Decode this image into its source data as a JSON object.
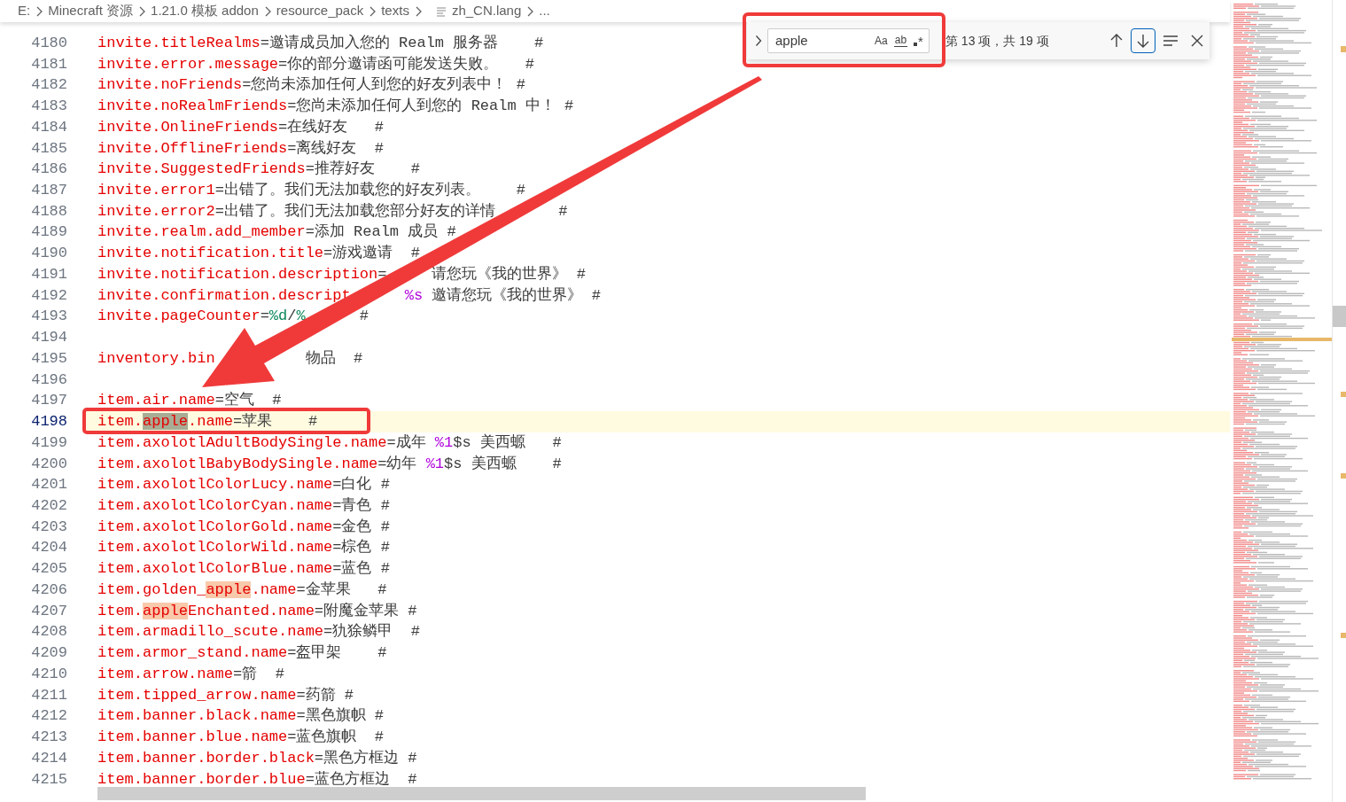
{
  "breadcrumb": [
    {
      "kind": "folder",
      "text": "E:"
    },
    {
      "kind": "folder",
      "text": "Minecraft 资源"
    },
    {
      "kind": "folder",
      "text": "1.21.0 模板 addon"
    },
    {
      "kind": "folder",
      "text": "resource_pack"
    },
    {
      "kind": "folder",
      "text": "texts"
    },
    {
      "kind": "file",
      "text": "zh_CN.lang"
    },
    {
      "kind": "more",
      "text": "..."
    }
  ],
  "find_widget": {
    "query": "apple",
    "toggles": [
      {
        "kind": "match_case",
        "label": "Aa",
        "on": false
      },
      {
        "kind": "whole_word",
        "label": "ab",
        "on": false
      },
      {
        "kind": "regex",
        "label": "*",
        "on": false
      }
    ],
    "result": "第 13 项，共 19 项"
  },
  "editor": {
    "lines": [
      {
        "number": "4180",
        "current": false,
        "tokens": [
          {
            "kind": "key",
            "text": "invite.titleRealms"
          },
          {
            "kind": "value",
            "text": "=邀请成员加入您的 Realm 服务器    #"
          }
        ]
      },
      {
        "number": "4181",
        "current": false,
        "tokens": [
          {
            "kind": "key",
            "text": "invite.error.message"
          },
          {
            "kind": "value",
            "text": "=你的部分邀请函可能发送失败。   #"
          }
        ]
      },
      {
        "number": "4182",
        "current": false,
        "tokens": [
          {
            "kind": "key",
            "text": "invite.noFriends"
          },
          {
            "kind": "value",
            "text": "=您尚未添加任何人到您的好友列表中！ #"
          }
        ]
      },
      {
        "number": "4183",
        "current": false,
        "tokens": [
          {
            "kind": "key",
            "text": "invite.noRealmFriends"
          },
          {
            "kind": "value",
            "text": "=您尚未添加任何人到您的 Realm 中！ #"
          }
        ]
      },
      {
        "number": "4184",
        "current": false,
        "tokens": [
          {
            "kind": "key",
            "text": "invite.OnlineFriends"
          },
          {
            "kind": "value",
            "text": "=在线好友   #"
          }
        ]
      },
      {
        "number": "4185",
        "current": false,
        "tokens": [
          {
            "kind": "key",
            "text": "invite.OfflineFriends"
          },
          {
            "kind": "value",
            "text": "=离线好友  #"
          }
        ]
      },
      {
        "number": "4186",
        "current": false,
        "tokens": [
          {
            "kind": "key",
            "text": "invite.SuggestedFriends"
          },
          {
            "kind": "value",
            "text": "=推荐好友    #"
          }
        ]
      },
      {
        "number": "4187",
        "current": false,
        "tokens": [
          {
            "kind": "key",
            "text": "invite.error1"
          },
          {
            "kind": "value",
            "text": "=出错了。我们无法加载您的好友列表。    #"
          }
        ]
      },
      {
        "number": "4188",
        "current": false,
        "tokens": [
          {
            "kind": "key",
            "text": "invite.error2"
          },
          {
            "kind": "value",
            "text": "=出错了。我们无法加载您部分好友的详情       #"
          }
        ]
      },
      {
        "number": "4189",
        "current": false,
        "tokens": [
          {
            "kind": "key",
            "text": "invite.realm.add_member"
          },
          {
            "kind": "value",
            "text": "=添加 Realm 成员 #"
          }
        ]
      },
      {
        "number": "4190",
        "current": false,
        "tokens": [
          {
            "kind": "key",
            "text": "invite.notification.title"
          },
          {
            "kind": "value",
            "text": "=游戏邀请  #"
          }
        ]
      },
      {
        "number": "4191",
        "current": false,
        "tokens": [
          {
            "kind": "key",
            "text": "invite.notification.description"
          },
          {
            "kind": "value",
            "text": "=     请您玩《我的世界》 #"
          }
        ]
      },
      {
        "number": "4192",
        "current": false,
        "tokens": [
          {
            "kind": "key",
            "text": "invite.confirmation.descript      "
          },
          {
            "kind": "format",
            "text": "%s"
          },
          {
            "kind": "value",
            "text": " 邀请您玩《我的世界》 #"
          }
        ]
      },
      {
        "number": "4193",
        "current": false,
        "tokens": [
          {
            "kind": "key",
            "text": "invite.pageCounter"
          },
          {
            "kind": "value",
            "text": "="
          },
          {
            "kind": "counter",
            "text": "%d"
          },
          {
            "kind": "value",
            "text": "/"
          },
          {
            "kind": "counter",
            "text": "%"
          },
          {
            "kind": "value",
            "text": "      #"
          }
        ]
      },
      {
        "number": "4194",
        "current": false
      },
      {
        "number": "4195",
        "current": false,
        "tokens": [
          {
            "kind": "key",
            "text": "inventory.bin"
          },
          {
            "kind": "value",
            "text": "          物品  #"
          }
        ]
      },
      {
        "number": "4196",
        "current": false
      },
      {
        "number": "4197",
        "current": false,
        "tokens": [
          {
            "kind": "key",
            "text": "item.air.name"
          },
          {
            "kind": "value",
            "text": "=空气  #"
          }
        ]
      },
      {
        "number": "4198",
        "current": true,
        "tokens": [
          {
            "kind": "key",
            "text": "item."
          },
          {
            "kind": "key",
            "text": "apple",
            "match": true,
            "current_match": true
          },
          {
            "kind": "key",
            "text": ".name"
          },
          {
            "kind": "value",
            "text": "=苹果    #"
          }
        ]
      },
      {
        "number": "4199",
        "current": false,
        "tokens": [
          {
            "kind": "key",
            "text": "item.axolotlAdultBodySingle.name"
          },
          {
            "kind": "value",
            "text": "=成年 "
          },
          {
            "kind": "format",
            "text": "%1"
          },
          {
            "kind": "value",
            "text": "$s 美西螈   #"
          }
        ]
      },
      {
        "number": "4200",
        "current": false,
        "tokens": [
          {
            "kind": "key",
            "text": "item.axolotlBabyBodySingle.name"
          },
          {
            "kind": "value",
            "text": "=幼年 "
          },
          {
            "kind": "format",
            "text": "%1"
          },
          {
            "kind": "value",
            "text": "$s 美西螈    #"
          }
        ]
      },
      {
        "number": "4201",
        "current": false,
        "tokens": [
          {
            "kind": "key",
            "text": "item.axolotlColorLucy.name"
          },
          {
            "kind": "value",
            "text": "=白化 #"
          }
        ]
      },
      {
        "number": "4202",
        "current": false,
        "tokens": [
          {
            "kind": "key",
            "text": "item.axolotlColorCyan.name"
          },
          {
            "kind": "value",
            "text": "=青色 #"
          }
        ]
      },
      {
        "number": "4203",
        "current": false,
        "tokens": [
          {
            "kind": "key",
            "text": "item.axolotlColorGold.name"
          },
          {
            "kind": "value",
            "text": "=金色 #"
          }
        ]
      },
      {
        "number": "4204",
        "current": false,
        "tokens": [
          {
            "kind": "key",
            "text": "item.axolotlColorWild.name"
          },
          {
            "kind": "value",
            "text": "=棕色 #"
          }
        ]
      },
      {
        "number": "4205",
        "current": false,
        "tokens": [
          {
            "kind": "key",
            "text": "item.axolotlColorBlue.name"
          },
          {
            "kind": "value",
            "text": "=蓝色 #"
          }
        ]
      },
      {
        "number": "4206",
        "current": false,
        "tokens": [
          {
            "kind": "key",
            "text": "item.golden_"
          },
          {
            "kind": "key",
            "text": "apple",
            "match": true,
            "current_match": false
          },
          {
            "kind": "key",
            "text": ".name"
          },
          {
            "kind": "value",
            "text": "=金苹果   #"
          }
        ]
      },
      {
        "number": "4207",
        "current": false,
        "tokens": [
          {
            "kind": "key",
            "text": "item."
          },
          {
            "kind": "key",
            "text": "apple",
            "match": true,
            "current_match": false
          },
          {
            "kind": "key",
            "text": "Enchanted.name"
          },
          {
            "kind": "value",
            "text": "=附魔金苹果 #"
          }
        ]
      },
      {
        "number": "4208",
        "current": false,
        "tokens": [
          {
            "kind": "key",
            "text": "item.armadillo_scute.name"
          },
          {
            "kind": "value",
            "text": "=犰狳鳞甲  #"
          }
        ]
      },
      {
        "number": "4209",
        "current": false,
        "tokens": [
          {
            "kind": "key",
            "text": "item.armor_stand.name"
          },
          {
            "kind": "value",
            "text": "=盔甲架    #"
          }
        ]
      },
      {
        "number": "4210",
        "current": false,
        "tokens": [
          {
            "kind": "key",
            "text": "item.arrow.name"
          },
          {
            "kind": "value",
            "text": "=箭  #"
          }
        ]
      },
      {
        "number": "4211",
        "current": false,
        "tokens": [
          {
            "kind": "key",
            "text": "item.tipped_arrow.name"
          },
          {
            "kind": "value",
            "text": "=药箭 #"
          }
        ]
      },
      {
        "number": "4212",
        "current": false,
        "tokens": [
          {
            "kind": "key",
            "text": "item.banner.black.name"
          },
          {
            "kind": "value",
            "text": "=黑色旗帜 #"
          }
        ]
      },
      {
        "number": "4213",
        "current": false,
        "tokens": [
          {
            "kind": "key",
            "text": "item.banner.blue.name"
          },
          {
            "kind": "value",
            "text": "=蓝色旗帜  #"
          }
        ]
      },
      {
        "number": "4214",
        "current": false,
        "tokens": [
          {
            "kind": "key",
            "text": "item.banner.border.black"
          },
          {
            "kind": "value",
            "text": "=黑色方框边 #"
          }
        ]
      },
      {
        "number": "4215",
        "current": false,
        "tokens": [
          {
            "kind": "key",
            "text": "item.banner.border.blue"
          },
          {
            "kind": "value",
            "text": "=蓝色方框边  #"
          }
        ]
      }
    ]
  }
}
